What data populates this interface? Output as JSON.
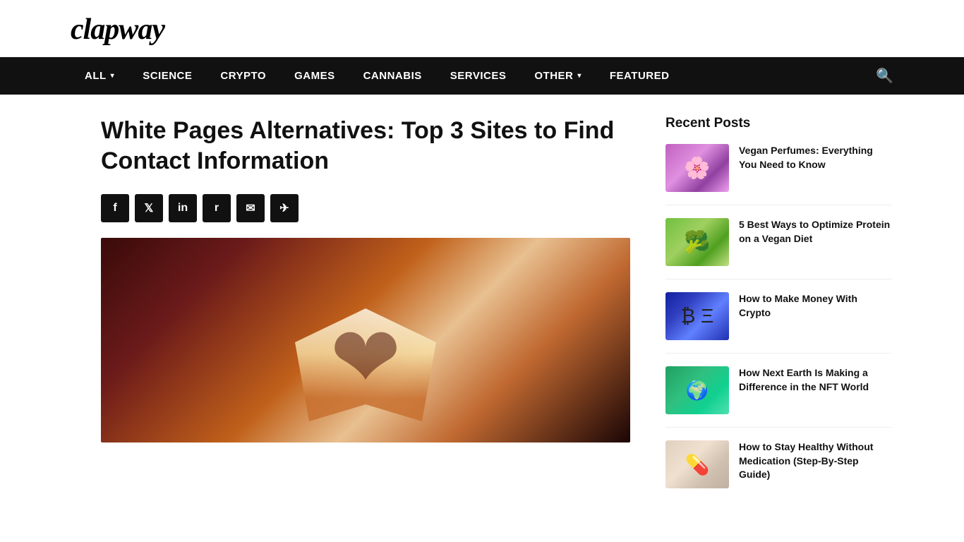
{
  "site": {
    "logo": "clapway"
  },
  "navbar": {
    "items": [
      {
        "label": "ALL",
        "has_dropdown": true
      },
      {
        "label": "SCIENCE",
        "has_dropdown": false
      },
      {
        "label": "CRYPTO",
        "has_dropdown": false
      },
      {
        "label": "GAMES",
        "has_dropdown": false
      },
      {
        "label": "CANNABIS",
        "has_dropdown": false
      },
      {
        "label": "SERVICES",
        "has_dropdown": false
      },
      {
        "label": "OTHER",
        "has_dropdown": true
      },
      {
        "label": "FEATURED",
        "has_dropdown": false
      }
    ]
  },
  "article": {
    "title": "White Pages Alternatives: Top 3 Sites to Find Contact Information"
  },
  "share_buttons": [
    {
      "icon": "f",
      "label": "Facebook",
      "name": "facebook-share"
    },
    {
      "icon": "𝕏",
      "label": "Twitter",
      "name": "twitter-share"
    },
    {
      "icon": "in",
      "label": "LinkedIn",
      "name": "linkedin-share"
    },
    {
      "icon": "r",
      "label": "Reddit",
      "name": "reddit-share"
    },
    {
      "icon": "✉",
      "label": "Email",
      "name": "email-share"
    },
    {
      "icon": "✈",
      "label": "Telegram",
      "name": "telegram-share"
    }
  ],
  "sidebar": {
    "recent_posts_title": "Recent Posts",
    "posts": [
      {
        "title": "Vegan Perfumes: Everything You Need to Know",
        "thumb_class": "thumb-vegan",
        "name": "vegan-perfumes-post"
      },
      {
        "title": "5 Best Ways to Optimize Protein on a Vegan Diet",
        "thumb_class": "thumb-protein",
        "name": "optimize-protein-post"
      },
      {
        "title": "How to Make Money With Crypto",
        "thumb_class": "thumb-crypto",
        "name": "make-money-crypto-post"
      },
      {
        "title": "How Next Earth Is Making a Difference in the NFT World",
        "thumb_class": "thumb-nextearth",
        "name": "next-earth-post"
      },
      {
        "title": "How to Stay Healthy Without Medication (Step-By-Step Guide)",
        "thumb_class": "thumb-healthy",
        "name": "stay-healthy-post"
      }
    ]
  }
}
